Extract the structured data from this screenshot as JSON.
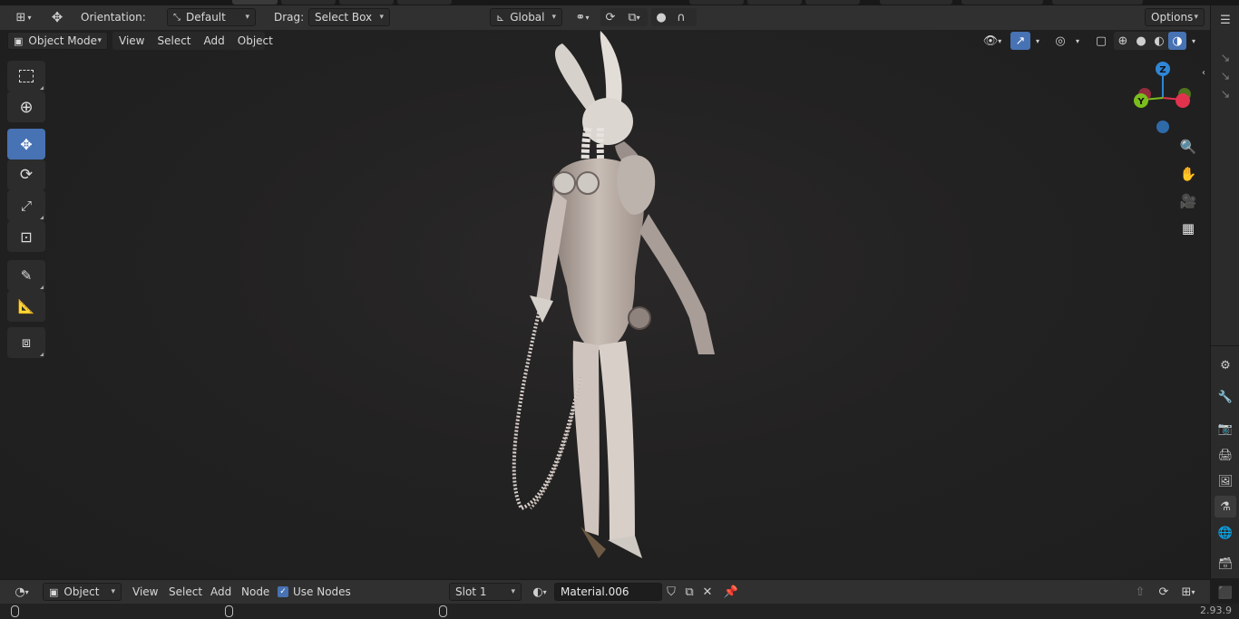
{
  "header": {
    "orientation_label": "Orientation:",
    "orientation_value": "Default",
    "drag_label": "Drag:",
    "drag_value": "Select Box",
    "transform_space": "Global",
    "options_label": "Options"
  },
  "viewport_header": {
    "mode": "Object Mode",
    "menus": [
      "View",
      "Select",
      "Add",
      "Object"
    ]
  },
  "gizmo": {
    "z": "Z",
    "y": "Y",
    "x_color": "#e2334e",
    "y_color": "#7bbd1e",
    "z_color": "#2f86d6"
  },
  "bottom": {
    "editor_mode": "Object",
    "menus": [
      "View",
      "Select",
      "Add",
      "Node"
    ],
    "use_nodes_label": "Use Nodes",
    "use_nodes_checked": true,
    "slot": "Slot 1",
    "material": "Material.006"
  },
  "status": {
    "version": "2.93.9"
  },
  "colors": {
    "accent": "#4772b3",
    "header_bg": "#303030",
    "viewport_bg": "#232222"
  }
}
